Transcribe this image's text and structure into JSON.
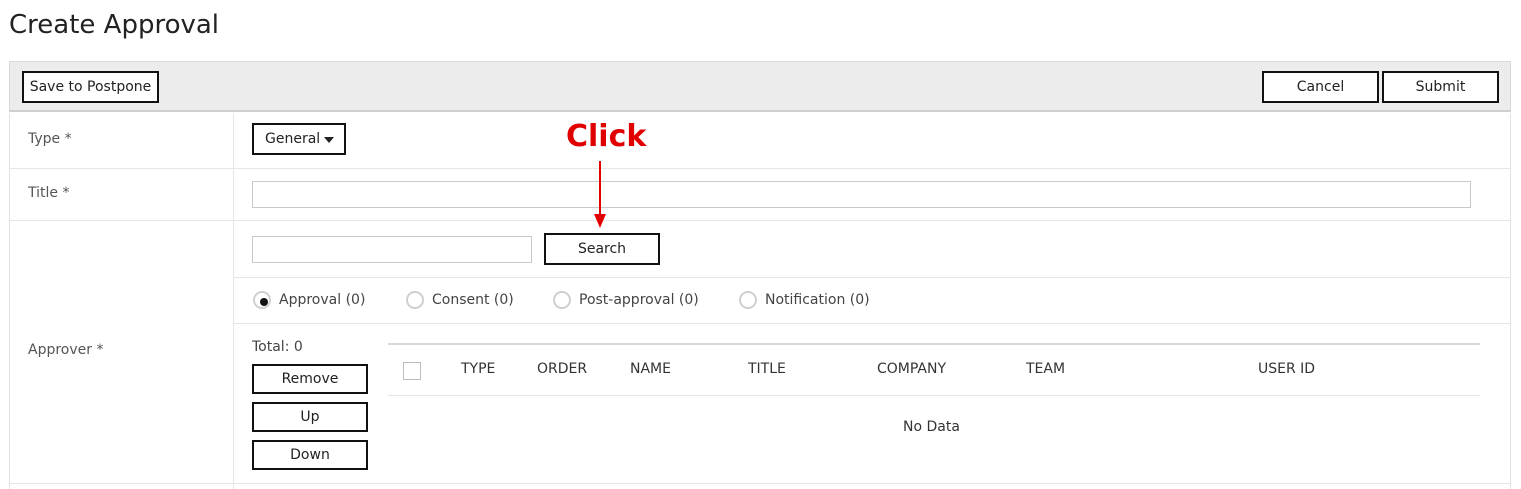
{
  "page": {
    "title": "Create Approval"
  },
  "toolbar": {
    "postpone": "Save to Postpone",
    "cancel": "Cancel",
    "submit": "Submit"
  },
  "form": {
    "type": {
      "label": "Type *",
      "selected": "General"
    },
    "title": {
      "label": "Title *",
      "value": ""
    },
    "approver": {
      "label": "Approver *",
      "search_value": "",
      "search_button": "Search",
      "radios": [
        {
          "label": "Approval (0)",
          "checked": true
        },
        {
          "label": "Consent (0)",
          "checked": false
        },
        {
          "label": "Post-approval (0)",
          "checked": false
        },
        {
          "label": "Notification (0)",
          "checked": false
        }
      ],
      "total": "Total: 0",
      "buttons": {
        "remove": "Remove",
        "up": "Up",
        "down": "Down"
      },
      "columns": [
        "TYPE",
        "ORDER",
        "NAME",
        "TITLE",
        "COMPANY",
        "TEAM",
        "USER ID"
      ],
      "empty_text": "No Data"
    }
  },
  "annotation": {
    "text": "Click",
    "color": "#e00000"
  }
}
